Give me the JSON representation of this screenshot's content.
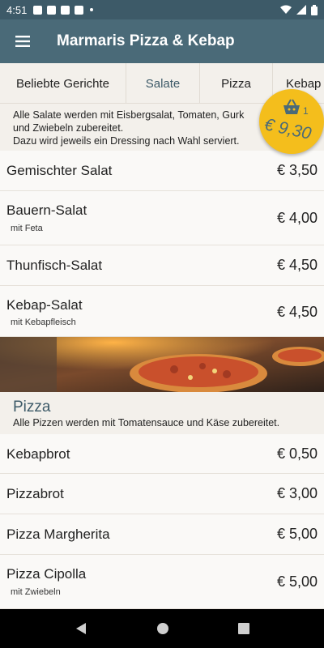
{
  "status_bar": {
    "time": "4:51",
    "icons": [
      "notification-square-icon",
      "notification-square-icon",
      "notification-square-icon",
      "notification-square-icon",
      "dot-icon",
      "wifi-icon",
      "signal-icon",
      "battery-icon"
    ]
  },
  "app_bar": {
    "title": "Marmaris Pizza & Kebap",
    "menu_icon": "hamburger-menu-icon"
  },
  "tabs": [
    {
      "label": "Beliebte Gerichte",
      "active": false
    },
    {
      "label": "Salate",
      "active": true
    },
    {
      "label": "Pizza",
      "active": false
    },
    {
      "label": "Kebap",
      "active": false
    }
  ],
  "salads_note": {
    "line1": "Alle Salate werden mit Eisbergsalat, Tomaten, Gurk",
    "line2": "und Zwiebeln zubereitet.",
    "line3": "Dazu wird jeweils ein Dressing nach Wahl serviert."
  },
  "cart": {
    "count": "1",
    "total": "€ 9,30",
    "icon": "shopping-basket-icon",
    "color": "#f4be1c"
  },
  "salads": [
    {
      "name": "Gemischter Salat",
      "sub": "",
      "price": "€ 3,50"
    },
    {
      "name": "Bauern-Salat",
      "sub": "mit Feta",
      "price": "€ 4,00"
    },
    {
      "name": "Thunfisch-Salat",
      "sub": "",
      "price": "€ 4,50"
    },
    {
      "name": "Kebap-Salat",
      "sub": "mit Kebapfleisch",
      "price": "€ 4,50"
    }
  ],
  "pizza_section": {
    "title": "Pizza",
    "description": "Alle Pizzen werden mit Tomatensauce und Käse zubereitet."
  },
  "pizzas": [
    {
      "name": "Kebapbrot",
      "sub": "",
      "price": "€ 0,50"
    },
    {
      "name": "Pizzabrot",
      "sub": "",
      "price": "€ 3,00"
    },
    {
      "name": "Pizza Margherita",
      "sub": "",
      "price": "€ 5,00"
    },
    {
      "name": "Pizza Cipolla",
      "sub": "mit Zwiebeln",
      "price": "€ 5,00"
    }
  ],
  "nav_bar": {
    "back": "back-icon",
    "home": "home-icon",
    "recents": "recents-icon"
  },
  "colors": {
    "primary": "#4a6a78",
    "status_bar": "#3d5a68",
    "accent": "#f4be1c",
    "background": "#f5f2ed"
  }
}
